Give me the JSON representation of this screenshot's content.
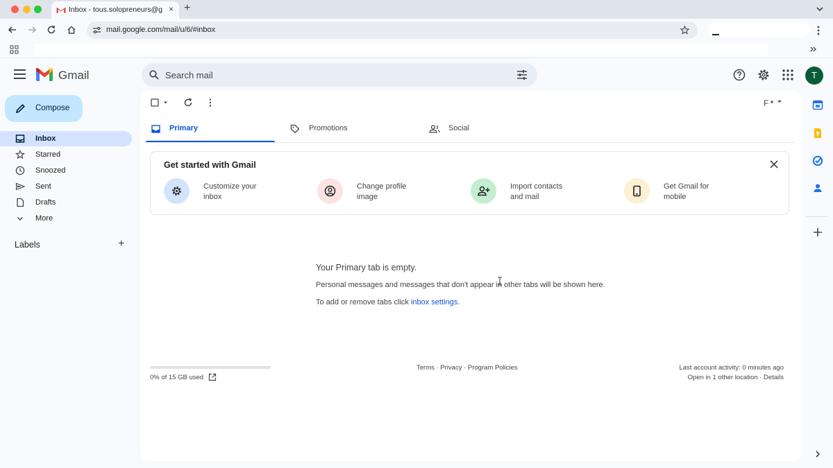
{
  "browser": {
    "tab_title": "Inbox - tous.solopreneurs@gm",
    "tab_close": "×",
    "new_tab": "+",
    "url": "mail.google.com/mail/u/6/#inbox"
  },
  "gmail": {
    "brand": "Gmail",
    "search_placeholder": "Search mail",
    "avatar_letter": "T",
    "compose_label": "Compose",
    "nav": [
      {
        "label": "Inbox",
        "icon": "inbox-icon"
      },
      {
        "label": "Starred",
        "icon": "star-icon"
      },
      {
        "label": "Snoozed",
        "icon": "clock-icon"
      },
      {
        "label": "Sent",
        "icon": "send-icon"
      },
      {
        "label": "Drafts",
        "icon": "draft-icon"
      },
      {
        "label": "More",
        "icon": "chevron-down-icon"
      }
    ],
    "labels_title": "Labels",
    "labels_add": "+",
    "input_tool": "F",
    "tabs": [
      {
        "label": "Primary",
        "icon": "inbox-icon"
      },
      {
        "label": "Promotions",
        "icon": "tag-icon"
      },
      {
        "label": "Social",
        "icon": "people-icon"
      }
    ],
    "get_started": {
      "title": "Get started with Gmail",
      "items": [
        {
          "line1": "Customize your",
          "line2": "inbox",
          "color": "#d3e3fd"
        },
        {
          "line1": "Change profile",
          "line2": "image",
          "color": "#fce3e3"
        },
        {
          "line1": "Import contacts",
          "line2": "and mail",
          "color": "#c4eed0"
        },
        {
          "line1": "Get Gmail for",
          "line2": "mobile",
          "color": "#fdf0d3"
        }
      ]
    },
    "empty": {
      "title": "Your Primary tab is empty.",
      "line1": "Personal messages and messages that don't appear in other tabs will be shown here.",
      "line2_prefix": "To add or remove tabs click ",
      "line2_link": "inbox settings",
      "line2_suffix": "."
    },
    "footer": {
      "storage": "0% of 15 GB used",
      "storage_percent": 0,
      "policies": "Terms · Privacy · Program Policies",
      "activity": "Last account activity: 0 minutes ago",
      "location": "Open in 1 other location · Details"
    }
  },
  "colors": {
    "accent": "#0b57d0",
    "compose_bg": "#c2e7ff",
    "active_nav": "#d3e3fd"
  }
}
